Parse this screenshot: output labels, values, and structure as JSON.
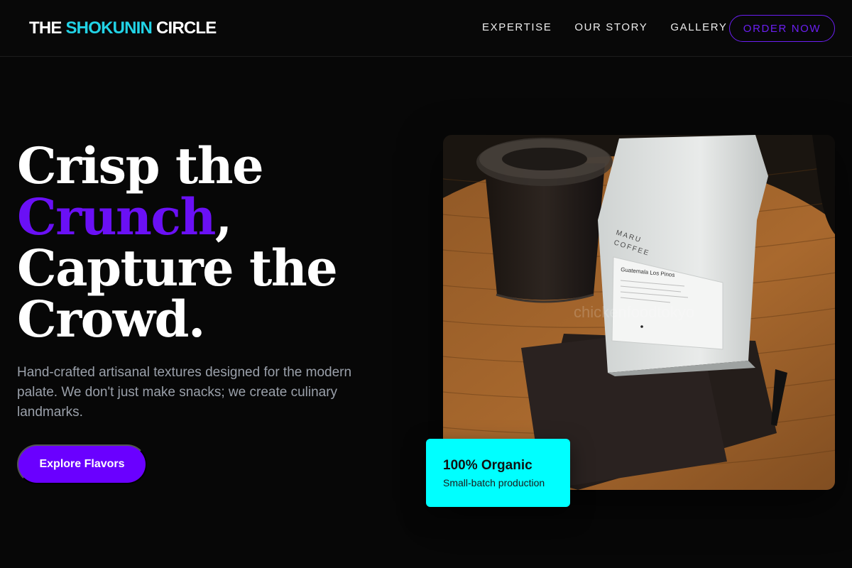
{
  "brand": {
    "part1": "THE ",
    "accent": "SHOKUNIN",
    "part2": " CIRCLE"
  },
  "nav": {
    "links": [
      "EXPERTISE",
      "OUR STORY",
      "GALLERY"
    ],
    "cta": "ORDER NOW"
  },
  "hero": {
    "line1": "Crisp the",
    "highlight": "Crunch",
    "comma": ",",
    "line3": "Capture the",
    "line4": "Crowd.",
    "subtitle": "Hand-crafted artisanal textures designed for the modern palate. We don't just make snacks; we create culinary landmarks.",
    "button": "Explore Flavors"
  },
  "photo": {
    "bag_brand_line1": "MARU",
    "bag_brand_line2": "COFFEE",
    "bag_label": "Guatemala Los Pinos",
    "watermark": "chickenfoodtokyo"
  },
  "badge": {
    "title": "100% Organic",
    "subtitle": "Small-batch production"
  },
  "colors": {
    "accent_cyan": "#00ffff",
    "accent_violet": "#6a00ff",
    "brand_cyan": "#22d3e6",
    "background": "#070707"
  }
}
